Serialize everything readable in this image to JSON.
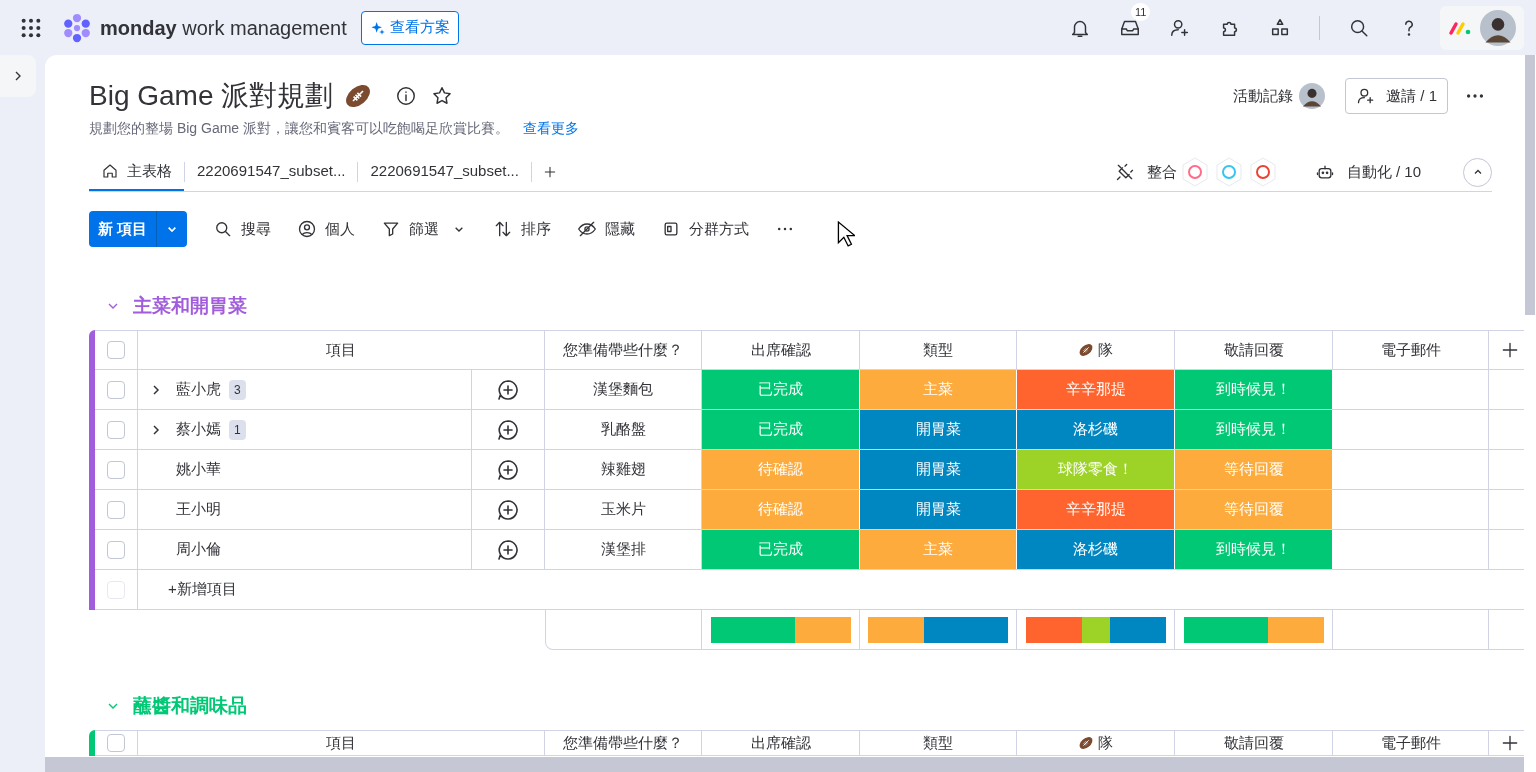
{
  "topbar": {
    "logo_bold": "monday",
    "logo_rest": "work management",
    "plans_button": "查看方案",
    "inbox_badge": "11"
  },
  "board": {
    "title": "Big Game 派對規劃",
    "description": "規劃您的整場 Big Game 派對，讓您和賓客可以吃飽喝足欣賞比賽。",
    "see_more": "查看更多",
    "activity": "活動記錄",
    "invite": "邀請 / 1"
  },
  "tabs": [
    {
      "label": "主表格",
      "kind": "home",
      "selected": true
    },
    {
      "label": "2220691547_subset...",
      "kind": "view",
      "selected": false
    },
    {
      "label": "2220691547_subset...",
      "kind": "view",
      "selected": false
    }
  ],
  "integrate": "整合",
  "automate": "自動化 / 10",
  "toolbar": {
    "new_item": "新 項目",
    "items": [
      {
        "label": "搜尋",
        "kind": "search"
      },
      {
        "label": "個人",
        "kind": "person"
      },
      {
        "label": "篩選",
        "kind": "filter"
      },
      {
        "label": "排序",
        "kind": "sort"
      },
      {
        "label": "隱藏",
        "kind": "hide"
      },
      {
        "label": "分群方式",
        "kind": "group"
      }
    ]
  },
  "groups": [
    {
      "name": "主菜和開胃菜",
      "color": "#a25ddc",
      "expanded": true,
      "all_checked": false,
      "add_item": "+新增項目",
      "new_row_checked": false,
      "columns": [
        {
          "label": "項目",
          "kind": "plain"
        },
        {
          "label": "您準備帶些什麼？",
          "kind": "plain"
        },
        {
          "label": "出席確認",
          "kind": "plain"
        },
        {
          "label": "類型",
          "kind": "plain"
        },
        {
          "label": "隊",
          "kind": "football"
        },
        {
          "label": "敬請回覆",
          "kind": "plain"
        },
        {
          "label": "電子郵件",
          "kind": "plain"
        }
      ],
      "rows": [
        {
          "checked": false,
          "cells": [
            {
              "text": "藍小虎",
              "subitems": "3",
              "expanded": false
            },
            {
              "text": "漢堡麵包"
            },
            {
              "text": "已完成",
              "color": "#00c875"
            },
            {
              "text": "主菜",
              "color": "#fdab3d"
            },
            {
              "text": "辛辛那提",
              "color": "#ff642e"
            },
            {
              "text": "到時候見！",
              "color": "#00c875"
            }
          ]
        },
        {
          "checked": false,
          "cells": [
            {
              "text": "蔡小嫣",
              "subitems": "1",
              "expanded": false
            },
            {
              "text": "乳酪盤"
            },
            {
              "text": "已完成",
              "color": "#00c875"
            },
            {
              "text": "開胃菜",
              "color": "#0086c0"
            },
            {
              "text": "洛杉磯",
              "color": "#0086c0"
            },
            {
              "text": "到時候見！",
              "color": "#00c875"
            }
          ]
        },
        {
          "checked": false,
          "cells": [
            {
              "text": "姚小華"
            },
            {
              "text": "辣雞翅"
            },
            {
              "text": "待確認",
              "color": "#fdab3d"
            },
            {
              "text": "開胃菜",
              "color": "#0086c0"
            },
            {
              "text": "球隊零食！",
              "color": "#9cd326"
            },
            {
              "text": "等待回覆",
              "color": "#fdab3d"
            }
          ]
        },
        {
          "checked": false,
          "cells": [
            {
              "text": "王小明"
            },
            {
              "text": "玉米片"
            },
            {
              "text": "待確認",
              "color": "#fdab3d"
            },
            {
              "text": "開胃菜",
              "color": "#0086c0"
            },
            {
              "text": "辛辛那提",
              "color": "#ff642e"
            },
            {
              "text": "等待回覆",
              "color": "#fdab3d"
            }
          ]
        },
        {
          "checked": false,
          "cells": [
            {
              "text": "周小倫"
            },
            {
              "text": "漢堡排"
            },
            {
              "text": "已完成",
              "color": "#00c875"
            },
            {
              "text": "主菜",
              "color": "#fdab3d"
            },
            {
              "text": "洛杉磯",
              "color": "#0086c0"
            },
            {
              "text": "到時候見！",
              "color": "#00c875"
            }
          ]
        }
      ],
      "summary": [
        [
          {
            "color": "#00c875"
          },
          {
            "color": "#fdab3d"
          }
        ],
        [
          {
            "color": "#fdab3d"
          },
          {
            "color": "#0086c0"
          }
        ],
        [
          {
            "color": "#ff642e"
          },
          {
            "color": "#9cd326"
          },
          {
            "color": "#0086c0"
          }
        ],
        [
          {
            "color": "#00c875"
          },
          {
            "color": "#fdab3d"
          }
        ]
      ]
    },
    {
      "name": "蘸醬和調味品",
      "color": "#00c875",
      "expanded": true,
      "all_checked": false,
      "columns": [
        {
          "label": "項目",
          "kind": "plain"
        },
        {
          "label": "您準備帶些什麼？",
          "kind": "plain"
        },
        {
          "label": "出席確認",
          "kind": "plain"
        },
        {
          "label": "類型",
          "kind": "plain"
        },
        {
          "label": "隊",
          "kind": "football"
        },
        {
          "label": "敬請回覆",
          "kind": "plain"
        },
        {
          "label": "電子郵件",
          "kind": "plain"
        }
      ]
    }
  ]
}
